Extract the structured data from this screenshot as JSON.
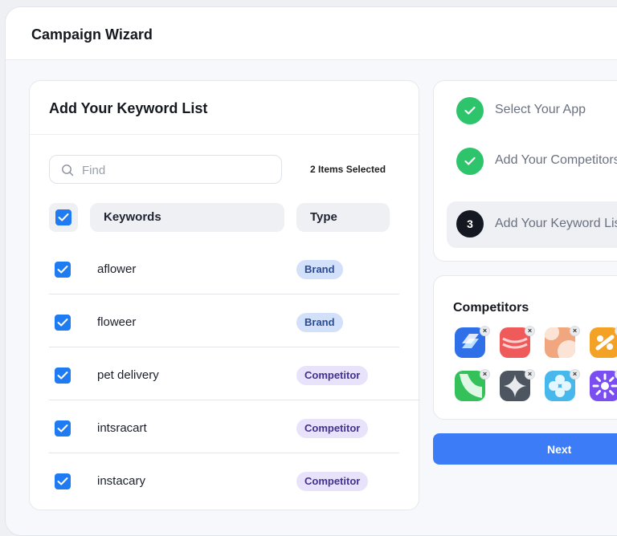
{
  "window": {
    "title": "Campaign Wizard"
  },
  "keyword_panel": {
    "title": "Add Your Keyword List",
    "search": {
      "placeholder": "Find",
      "value": "",
      "icon": "search-icon"
    },
    "selected_count": "2 Items Selected",
    "select_all_checked": true,
    "columns": {
      "keywords": "Keywords",
      "type": "Type"
    },
    "rows": [
      {
        "keyword": "aflower",
        "type": "Brand",
        "checked": true
      },
      {
        "keyword": "floweer",
        "type": "Brand",
        "checked": true
      },
      {
        "keyword": "pet delivery",
        "type": "Competitor",
        "checked": true
      },
      {
        "keyword": "intsracart",
        "type": "Competitor",
        "checked": true
      },
      {
        "keyword": "instacary",
        "type": "Competitor",
        "checked": true
      }
    ]
  },
  "steps": [
    {
      "label": "Select Your App",
      "status": "done"
    },
    {
      "label": "Add Your Competitors",
      "status": "done"
    },
    {
      "number": "3",
      "label": "Add Your Keyword List",
      "status": "current"
    }
  ],
  "competitors": {
    "title": "Competitors",
    "remove_label": "×",
    "apps": [
      {
        "icon": "blue-stacked-shapes-app-icon",
        "color": "#2f6fe8"
      },
      {
        "icon": "red-wave-app-icon",
        "color": "#ef5a5a"
      },
      {
        "icon": "peach-swirl-app-icon",
        "color": "#f0a77f"
      },
      {
        "icon": "orange-chain-app-icon",
        "color": "#f4a226"
      },
      {
        "icon": "green-leaf-app-icon",
        "color": "#35c15a"
      },
      {
        "icon": "gray-sparkle-app-icon",
        "color": "#4d5560"
      },
      {
        "icon": "cyan-clover-app-icon",
        "color": "#47b8ec"
      },
      {
        "icon": "purple-burst-app-icon",
        "color": "#7a4ef0"
      }
    ]
  },
  "next_button": {
    "label": "Next"
  },
  "colors": {
    "accent_blue": "#1f7bf2",
    "step_done_green": "#2dc46c",
    "brand_badge_bg": "#d3e0fa",
    "competitor_badge_bg": "#e8e3fb",
    "next_button_bg": "#3c7cf6"
  }
}
